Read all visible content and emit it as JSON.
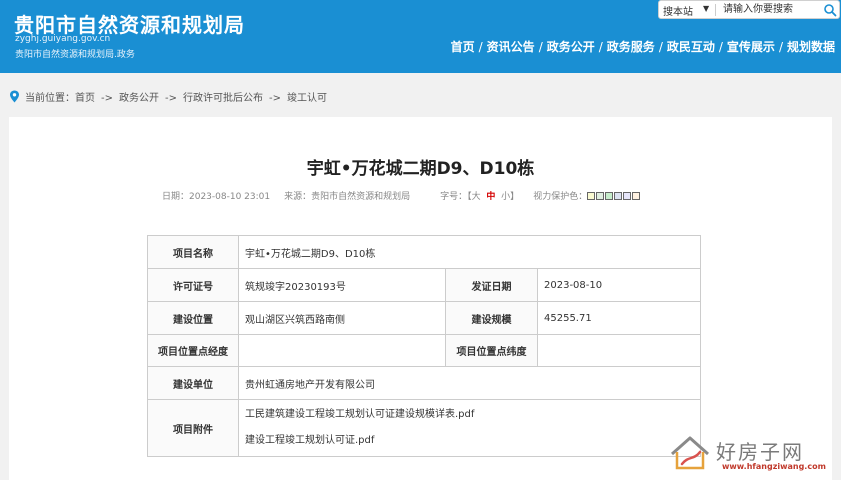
{
  "header": {
    "site_title": "贵阳市自然资源和规划局",
    "site_domain": "zyghj.guiyang.gov.cn",
    "site_subtitle": "贵阳市自然资源和规划局.政务",
    "search": {
      "scope": "搜本站",
      "placeholder": "请输入你要搜索",
      "icon": "search-icon"
    },
    "nav": [
      "首页",
      "资讯公告",
      "政务公开",
      "政务服务",
      "政民互动",
      "宣传展示",
      "规划数据"
    ],
    "nav_separator": "/",
    "brand_color": "#1a8fd3"
  },
  "breadcrumb": {
    "prefix": "当前位置：",
    "items": [
      "首页",
      "政务公开",
      "行政许可批后公布",
      "竣工认可"
    ],
    "separator": "->"
  },
  "article": {
    "title": "宇虹•万花城二期D9、D10栋",
    "date": "日期：2023-08-10 23:01",
    "source": "来源：贵阳市自然资源和规划局",
    "font_label": "字号：",
    "font_open": "【",
    "font_big": "大",
    "font_mid": "中",
    "font_small": "小",
    "font_close": "】",
    "eye_label": "视力保护色：",
    "eye_colors": [
      "#fafad2",
      "#e0eee0",
      "#c7edcc",
      "#dce2f1",
      "#e6e6fa",
      "#fff2e2"
    ]
  },
  "table": {
    "project_name_label": "项目名称",
    "project_name": "宇虹•万花城二期D9、D10栋",
    "permit_no_label": "许可证号",
    "permit_no": "筑规竣字20230193号",
    "issue_date_label": "发证日期",
    "issue_date": "2023-08-10",
    "location_label": "建设位置",
    "location": "观山湖区兴筑西路南侧",
    "scale_label": "建设规模",
    "scale": "45255.71",
    "longitude_label": "项目位置点经度",
    "longitude": "",
    "latitude_label": "项目位置点纬度",
    "latitude": "",
    "unit_label": "建设单位",
    "unit": "贵州虹通房地产开发有限公司",
    "attachments_label": "项目附件",
    "attachments": [
      "工民建筑建设工程竣工规划认可证建设规模详表.pdf",
      "建设工程竣工规划认可证.pdf"
    ]
  },
  "watermark": {
    "text": "好房子网",
    "url": "www.hfangziwang.com"
  }
}
